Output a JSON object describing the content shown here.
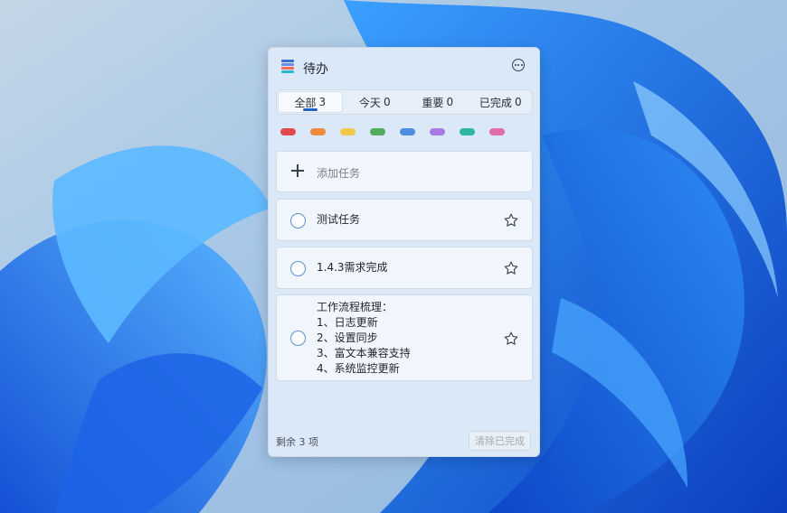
{
  "window": {
    "title": "待办"
  },
  "tabs": [
    {
      "label": "全部",
      "count": "3",
      "active": true
    },
    {
      "label": "今天",
      "count": "0",
      "active": false
    },
    {
      "label": "重要",
      "count": "0",
      "active": false
    },
    {
      "label": "已完成",
      "count": "0",
      "active": false
    }
  ],
  "color_filters": [
    "#e04a4f",
    "#ee8a3d",
    "#f2c84b",
    "#4fad5b",
    "#4c8fe0",
    "#a87be0",
    "#2fb5a3",
    "#e06fa7"
  ],
  "add_task": {
    "label": "添加任务"
  },
  "tasks": [
    {
      "lines": [
        "测试任务"
      ]
    },
    {
      "lines": [
        "1.4.3需求完成"
      ]
    },
    {
      "lines": [
        "工作流程梳理：",
        "1、日志更新",
        "2、设置同步",
        "3、富文本兼容支持",
        "4、系统监控更新"
      ]
    }
  ],
  "footer": {
    "remaining": "剩余 3 项",
    "clear_label": "清除已完成"
  },
  "app_icon_colors": [
    "#3b6fd6",
    "#6c8ee6",
    "#f26b5b",
    "#29b6c9"
  ]
}
